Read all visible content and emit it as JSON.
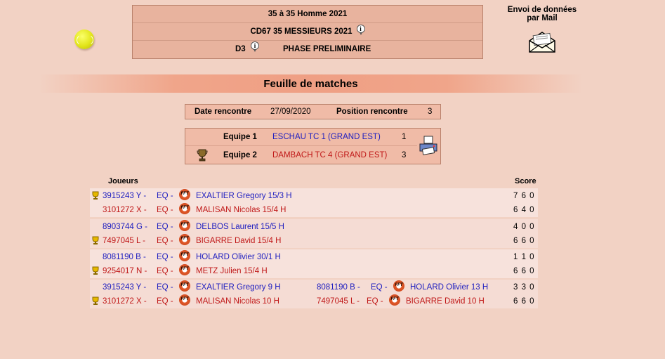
{
  "header": {
    "line1": "35  à 35  Homme  2021",
    "line2": "CD67 35 MESSIEURS 2021",
    "line3_division": "D3",
    "line3_phase": "PHASE PRELIMINAIRE"
  },
  "mail": {
    "label_line1": "Envoi de données",
    "label_line2": "par Mail"
  },
  "page_title": "Feuille de matches",
  "rencontre": {
    "date_label": "Date rencontre",
    "date_value": "27/09/2020",
    "position_label": "Position rencontre",
    "position_value": "3"
  },
  "teams": [
    {
      "label": "Equipe 1",
      "name": "ESCHAU TC 1 (GRAND EST)",
      "score": "1",
      "color": "#2020c0"
    },
    {
      "label": "Equipe 2",
      "name": "DAMBACH TC 4 (GRAND EST)",
      "score": "3",
      "color": "#c01818"
    }
  ],
  "columns": {
    "players": "Joueurs",
    "score": "Score"
  },
  "matches": [
    {
      "row1": {
        "id": "3915243 Y -",
        "eq": "EQ -",
        "name": "EXALTIER  Gregory  15/3 H",
        "score": "7 6 0"
      },
      "row2": {
        "id": "3101272 X -",
        "eq": "EQ -",
        "name": "MALISAN  Nicolas 15/4 H",
        "score": "6 4 0"
      }
    },
    {
      "row1": {
        "id": "8903744 G -",
        "eq": "EQ -",
        "name": "DELBOS  Laurent  15/5 H",
        "score": "4 0 0"
      },
      "row2": {
        "id": "7497045 L -",
        "eq": "EQ -",
        "name": "BIGARRE  David 15/4 H",
        "score": "6 6 0"
      }
    },
    {
      "row1": {
        "id": "8081190 B -",
        "eq": "EQ -",
        "name": "HOLARD  Olivier  30/1 H",
        "score": "1 1 0"
      },
      "row2": {
        "id": "9254017 N -",
        "eq": "EQ -",
        "name": "METZ  Julien 15/4 H",
        "score": "6 6 0"
      }
    },
    {
      "row1": {
        "id": "3915243 Y -",
        "eq": "EQ -",
        "name": "EXALTIER  Gregory  9 H",
        "id2": "8081190 B -",
        "eq2": "EQ -",
        "name2": "HOLARD  Olivier  13 H",
        "score": "3 3 0"
      },
      "row2": {
        "id": "3101272 X -",
        "eq": "EQ -",
        "name": "MALISAN  Nicolas 10 H",
        "id2": "7497045 L -",
        "eq2": "EQ -",
        "name2": "BIGARRE  David 10 H",
        "score": "6 6 0"
      }
    }
  ]
}
